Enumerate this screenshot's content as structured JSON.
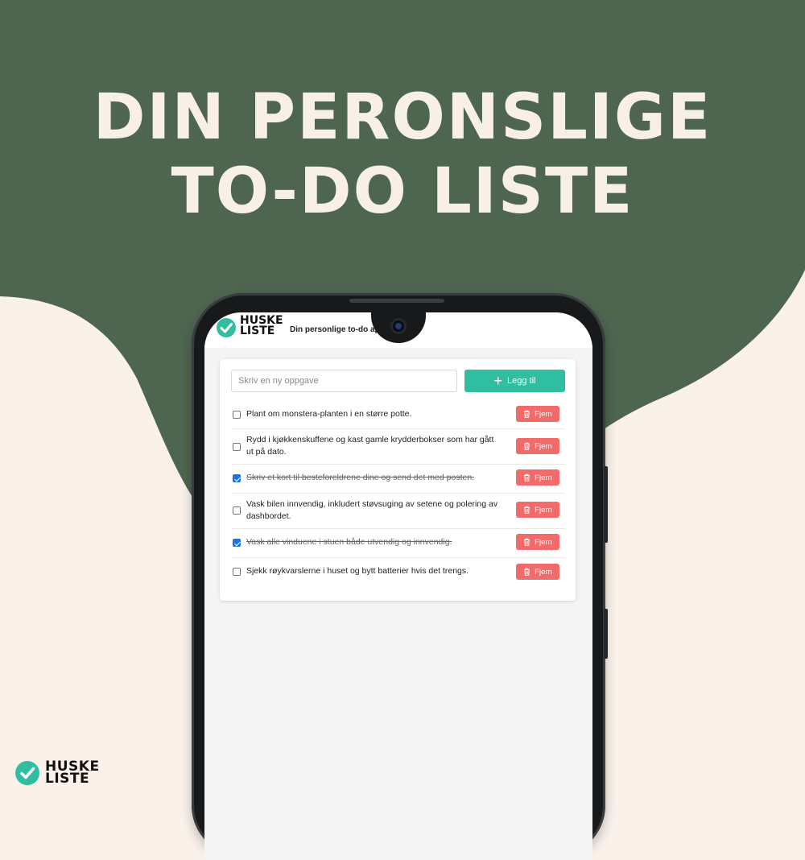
{
  "headline": {
    "line1": "DIN PERONSLIGE",
    "line2": "TO-DO LISTE"
  },
  "colors": {
    "background_green": "#4e6650",
    "background_cream": "#faf2ea",
    "headline_text": "#f8f0e6",
    "accent_teal": "#2fbfa0",
    "delete_red": "#f26b6b",
    "checkbox_blue": "#1a73e8"
  },
  "app": {
    "brand_line1": "HUSKE",
    "brand_line2": "LISTE",
    "subtitle": "Din personlige to-do ap",
    "logo_icon": "check-circle-icon"
  },
  "input": {
    "placeholder": "Skriv en ny oppgave",
    "value": ""
  },
  "add_button": {
    "label": "Legg til",
    "icon": "plus-icon"
  },
  "delete_label": "Fjern",
  "delete_icon": "trash-icon",
  "tasks": [
    {
      "text": "Plant om monstera-planten i en større potte.",
      "done": false
    },
    {
      "text": "Rydd i kjøkkenskuffene og kast gamle krydderbokser som har gått ut på dato.",
      "done": false
    },
    {
      "text": "Skriv et kort til besteforeldrene dine og send det med posten.",
      "done": true
    },
    {
      "text": "Vask bilen innvendig, inkludert støvsuging av setene og polering av dashbordet.",
      "done": false
    },
    {
      "text": "Vask alle vinduene i stuen både utvendig og innvendig.",
      "done": true
    },
    {
      "text": "Sjekk røykvarslerne i huset og bytt batterier hvis det trengs.",
      "done": false
    }
  ],
  "footer": {
    "brand_line1": "HUSKE",
    "brand_line2": "LISTE",
    "logo_icon": "check-circle-icon"
  }
}
